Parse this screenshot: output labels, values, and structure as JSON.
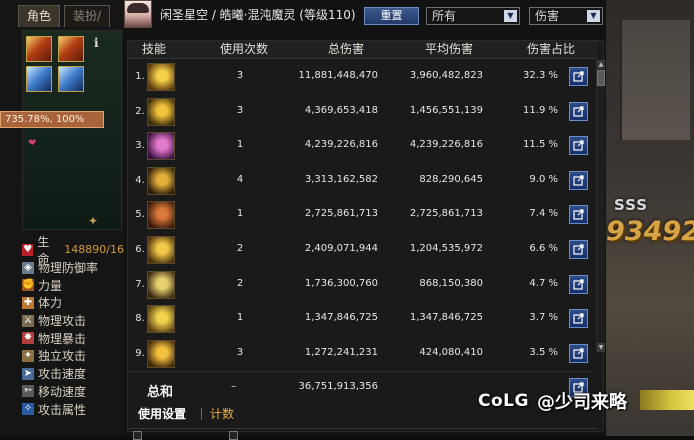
{
  "left_panel": {
    "tabs": [
      "角色",
      "装扮/"
    ],
    "info_icon": "i",
    "tooltip": "735.78%, 100%",
    "stats": [
      {
        "icon": "heart-icon",
        "label": "生命",
        "value": "148890/16"
      },
      {
        "icon": "shield-icon",
        "label": "物理防御率",
        "value": ""
      },
      {
        "icon": "fist-icon",
        "label": "力量",
        "value": ""
      },
      {
        "icon": "body-icon",
        "label": "体力",
        "value": ""
      },
      {
        "icon": "sword-icon",
        "label": "物理攻击",
        "value": ""
      },
      {
        "icon": "crit-icon",
        "label": "物理暴击",
        "value": ""
      },
      {
        "icon": "independent-icon",
        "label": "独立攻击",
        "value": ""
      },
      {
        "icon": "speed-icon",
        "label": "攻击速度",
        "value": ""
      },
      {
        "icon": "boot-icon",
        "label": "移动速度",
        "value": ""
      },
      {
        "icon": "element-icon",
        "label": "攻击属性",
        "value": ""
      }
    ]
  },
  "dialog": {
    "title": "闲圣星空 / 皓曦·混沌魔灵 (等级110)",
    "reset_label": "重置",
    "filter_select": "所有",
    "sort_select": "伤害",
    "columns": {
      "skill": "技能",
      "uses": "使用次数",
      "total": "总伤害",
      "avg": "平均伤害",
      "pct": "伤害占比"
    },
    "rows": [
      {
        "rank": "1.",
        "icon": "radiant-burst-skill-icon",
        "uses": "3",
        "total": "11,881,448,470",
        "avg": "3,960,482,823",
        "pct": "32.3 %",
        "color_a": "#f6d04a",
        "color_b": "#5a3a0a"
      },
      {
        "rank": "2.",
        "icon": "golden-lance-skill-icon",
        "uses": "3",
        "total": "4,369,653,418",
        "avg": "1,456,551,139",
        "pct": "11.9 %",
        "color_a": "#f2c23c",
        "color_b": "#3a2a08"
      },
      {
        "rank": "3.",
        "icon": "pink-orb-skill-icon",
        "uses": "1",
        "total": "4,239,226,816",
        "avg": "4,239,226,816",
        "pct": "11.5 %",
        "color_a": "#e47acc",
        "color_b": "#3a1040"
      },
      {
        "rank": "4.",
        "icon": "twin-claw-skill-icon",
        "uses": "4",
        "total": "3,313,162,582",
        "avg": "828,290,645",
        "pct": "9.0 %",
        "color_a": "#e4b03a",
        "color_b": "#2a1c08"
      },
      {
        "rank": "5.",
        "icon": "spiral-rune-skill-icon",
        "uses": "1",
        "total": "2,725,861,713",
        "avg": "2,725,861,713",
        "pct": "7.4 %",
        "color_a": "#d8783a",
        "color_b": "#3a180a"
      },
      {
        "rank": "6.",
        "icon": "sun-strike-skill-icon",
        "uses": "2",
        "total": "2,409,071,944",
        "avg": "1,204,535,972",
        "pct": "6.6 %",
        "color_a": "#f0c84a",
        "color_b": "#4a300a"
      },
      {
        "rank": "7.",
        "icon": "light-pillar-skill-icon",
        "uses": "2",
        "total": "1,736,300,760",
        "avg": "868,150,380",
        "pct": "4.7 %",
        "color_a": "#e8d070",
        "color_b": "#3a2a10"
      },
      {
        "rank": "8.",
        "icon": "crest-skill-icon",
        "uses": "1",
        "total": "1,347,846,725",
        "avg": "1,347,846,725",
        "pct": "3.7 %",
        "color_a": "#f0d24e",
        "color_b": "#5a4210"
      },
      {
        "rank": "9.",
        "icon": "flare-arc-skill-icon",
        "uses": "3",
        "total": "1,272,241,231",
        "avg": "424,080,410",
        "pct": "3.5 %",
        "color_a": "#f4c040",
        "color_b": "#402808"
      }
    ],
    "sum": {
      "label": "总和",
      "uses": "–",
      "total": "36,751,913,356"
    },
    "footer_tabs": {
      "active": "使用设置",
      "other": "计数"
    }
  },
  "background": {
    "sss": "SSS",
    "combo": "93492"
  },
  "watermark": {
    "logo": "CoLG",
    "text": "@少司来略"
  },
  "colors": {
    "accent_blue": "#23386a",
    "tooltip_orange": "#a9633a",
    "count_tab_gold": "#e8b040"
  }
}
